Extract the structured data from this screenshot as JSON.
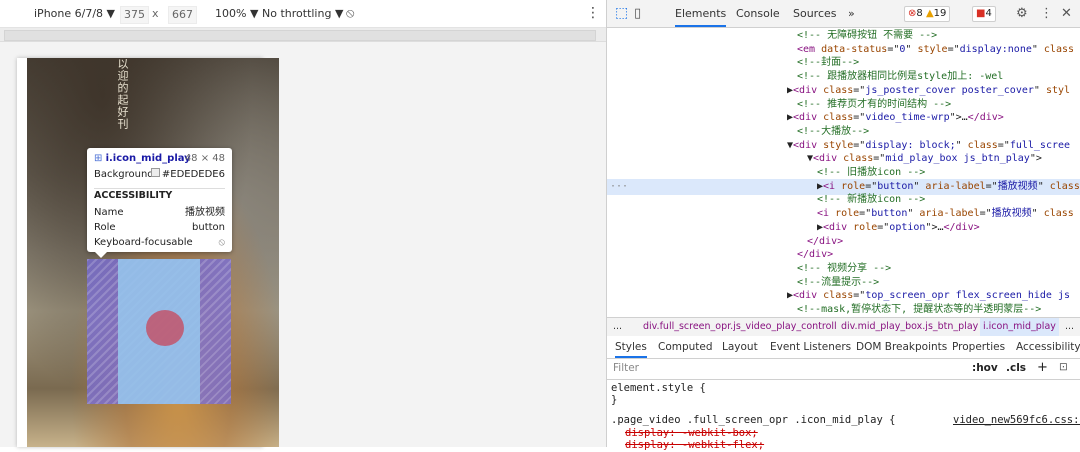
{
  "device_toolbar": {
    "device": "iPhone 6/7/8 ▼",
    "width": "375",
    "times": "x",
    "height": "667",
    "zoom": "100% ▼",
    "throttling": "No throttling ▼",
    "rotate_icon": "rotate-icon",
    "more": "⋮"
  },
  "page": {
    "vertical_text": "以迎的起好刊诗篇"
  },
  "tooltip": {
    "selector": "i.icon_mid_play",
    "size": "48 × 48",
    "background_label": "Background",
    "background_value": "#EDEDEDE6",
    "section": "ACCESSIBILITY",
    "name_label": "Name",
    "name_value": "播放视频",
    "role_label": "Role",
    "role_value": "button",
    "focus_label": "Keyboard-focusable"
  },
  "devtools": {
    "tabs": [
      "Elements",
      "Console",
      "Sources",
      "»"
    ],
    "errors": "8",
    "warnings": "19",
    "issues": "4",
    "code_lines": [
      {
        "indent": 0,
        "html": "<span class='cmt'>&lt;!-- 无障碍按钮 不需要 --&gt;</span>"
      },
      {
        "indent": 0,
        "html": "<span class='tag'>&lt;em</span> <span class='attr'>data-status</span>=\"<span class='val'>0</span>\" <span class='attr'>style</span>=\"<span class='val'>display:none</span>\" <span class='attr'>class</span>"
      },
      {
        "indent": 0,
        "html": "<span class='cmt'>&lt;!--封面--&gt;</span>"
      },
      {
        "indent": 0,
        "html": "<span class='cmt'>&lt;!-- 跟播放器相同比例是style加上:           -wel</span>"
      },
      {
        "indent": -1,
        "html": "▶<span class='tag'>&lt;div</span> <span class='attr'>class</span>=\"<span class='val'>js_poster_cover poster_cover</span>\" <span class='attr'>styl</span>"
      },
      {
        "indent": 0,
        "html": "<span class='cmt'>&lt;!-- 推荐页才有的时间结构 --&gt;</span>"
      },
      {
        "indent": -1,
        "html": "▶<span class='tag'>&lt;div</span> <span class='attr'>class</span>=\"<span class='val'>video_time-wrp</span>\"&gt;…<span class='tag'>&lt;/div&gt;</span>"
      },
      {
        "indent": 0,
        "html": "<span class='cmt'>&lt;!--大播放--&gt;</span>"
      },
      {
        "indent": -1,
        "html": "▼<span class='tag'>&lt;div</span> <span class='attr'>style</span>=\"<span class='val'>display: block;</span>\" <span class='attr'>class</span>=\"<span class='val'>full_scree</span>"
      },
      {
        "indent": 1,
        "html": "▼<span class='tag'>&lt;div</span> <span class='attr'>class</span>=\"<span class='val'>mid_play_box js_btn_play</span>\"&gt;"
      },
      {
        "indent": 2,
        "html": "<span class='cmt'>&lt;!-- 旧播放icon --&gt;</span>"
      },
      {
        "indent": 2,
        "sel": true,
        "html": "▶<span class='tag'>&lt;i</span> <span class='attr'>role</span>=\"<span class='val'>button</span>\" <span class='attr'>aria-label</span>=\"<span class='val'>播放视频</span>\" <span class='attr'>class</span>"
      },
      {
        "indent": 2,
        "html": "<span class='cmt'>&lt;!-- 新播放icon --&gt;</span>"
      },
      {
        "indent": 2,
        "html": "<span class='tag'>&lt;i</span> <span class='attr'>role</span>=\"<span class='val'>button</span>\" <span class='attr'>aria-label</span>=\"<span class='val'>播放视频</span>\" <span class='attr'>class</span>"
      },
      {
        "indent": 2,
        "html": "▶<span class='tag'>&lt;div</span> <span class='attr'>role</span>=\"<span class='val'>option</span>\"&gt;…<span class='tag'>&lt;/div&gt;</span>"
      },
      {
        "indent": 1,
        "html": "<span class='tag'>&lt;/div&gt;</span>"
      },
      {
        "indent": 0,
        "html": "<span class='tag'>&lt;/div&gt;</span>"
      },
      {
        "indent": 0,
        "html": "<span class='cmt'>&lt;!-- 视频分享 --&gt;</span>"
      },
      {
        "indent": 0,
        "html": "<span class='cmt'>&lt;!--流量提示--&gt;</span>"
      },
      {
        "indent": -1,
        "html": "▶<span class='tag'>&lt;div</span> <span class='attr'>class</span>=\"<span class='val'>top_screen_opr flex_screen_hide js</span>"
      },
      {
        "indent": 0,
        "html": "<span class='cmt'>&lt;!--mask,暂停状态下, 提醒状态等的半透明蒙层--&gt;</span>"
      }
    ],
    "breadcrumbs": [
      "...",
      "div.full_screen_opr.js_video_play_controll",
      "div.mid_play_box.js_btn_play",
      "i.icon_mid_play",
      "..."
    ],
    "style_tabs": [
      "Styles",
      "Computed",
      "Layout",
      "Event Listeners",
      "DOM Breakpoints",
      "Properties",
      "Accessibility"
    ],
    "filter_placeholder": "Filter",
    "hov": ":hov",
    "cls": ".cls",
    "plus": "+",
    "rule1_selector": "element.style {",
    "rule1_close": "}",
    "rule2_selector": ".page_video .full_screen_opr .icon_mid_play {",
    "rule2_source": "video_new569fc6.css:1",
    "rule2_decl1": "display: -webkit-box;",
    "rule2_decl2": "display: -webkit-flex;"
  }
}
